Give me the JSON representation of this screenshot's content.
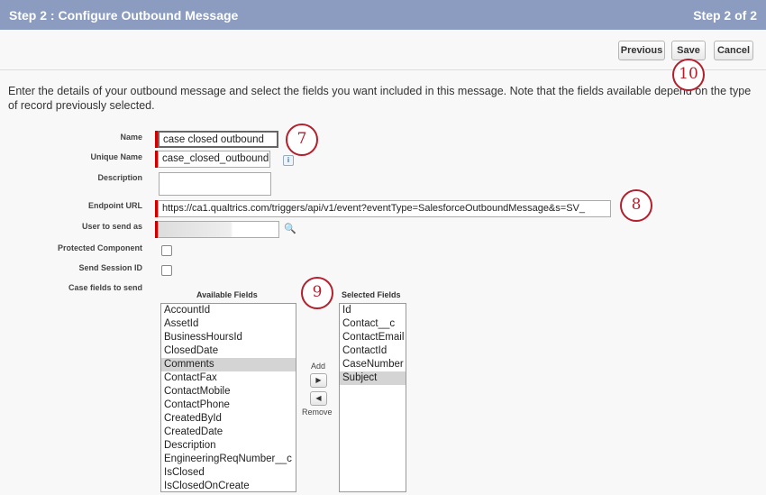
{
  "header": {
    "title": "Step 2 : Configure Outbound Message",
    "step": "Step 2 of 2"
  },
  "toolbar": {
    "previous": "Previous",
    "save": "Save",
    "cancel": "Cancel"
  },
  "intro": "Enter the details of your outbound message and select the fields you want included in this message. Note that the fields available depend on the type of record previously selected.",
  "form": {
    "name_label": "Name",
    "name_value": "case closed outbound",
    "unique_label": "Unique Name",
    "unique_value": "case_closed_outbound",
    "description_label": "Description",
    "description_value": "",
    "endpoint_label": "Endpoint URL",
    "endpoint_value": "https://ca1.qualtrics.com/triggers/api/v1/event?eventType=SalesforceOutboundMessage&s=SV_",
    "user_label": "User to send as",
    "protected_label": "Protected Component",
    "session_label": "Send Session ID",
    "fields_label": "Case fields to send"
  },
  "fields": {
    "available_header": "Available Fields",
    "selected_header": "Selected Fields",
    "add": "Add",
    "remove": "Remove",
    "available": [
      "AccountId",
      "AssetId",
      "BusinessHoursId",
      "ClosedDate",
      "Comments",
      "ContactFax",
      "ContactMobile",
      "ContactPhone",
      "CreatedById",
      "CreatedDate",
      "Description",
      "EngineeringReqNumber__c",
      "IsClosed",
      "IsClosedOnCreate"
    ],
    "available_selected": "Comments",
    "selected": [
      "Id",
      "Contact__c",
      "ContactEmail",
      "ContactId",
      "CaseNumber",
      "Subject"
    ],
    "selected_selected": "Subject"
  },
  "callouts": {
    "c7": "7",
    "c8": "8",
    "c9": "9",
    "c10": "10"
  }
}
